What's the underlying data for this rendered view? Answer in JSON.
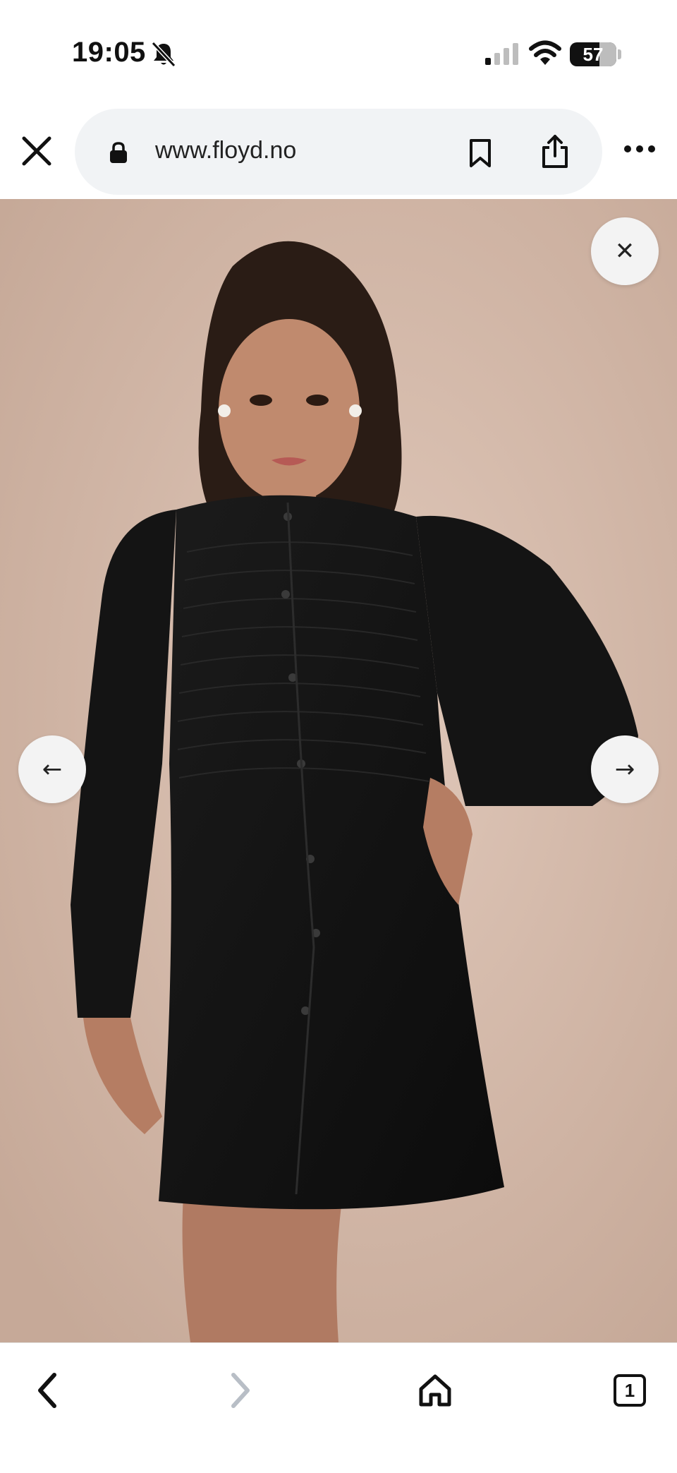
{
  "status_bar": {
    "time": "19:05",
    "battery_level": "57",
    "icons": [
      "bell-slash-icon",
      "cellular-signal-icon",
      "wifi-icon",
      "battery-icon"
    ]
  },
  "browser": {
    "url": "www.floyd.no",
    "icons": [
      "close-icon",
      "lock-icon",
      "bookmark-icon",
      "share-icon",
      "more-icon"
    ]
  },
  "product_image": {
    "close_glyph": "✕",
    "prev_glyph": "←",
    "next_glyph": "→"
  },
  "toolbar": {
    "tabs_count": "1",
    "icons": [
      "chevron-left-icon",
      "chevron-right-icon",
      "home-icon",
      "tabs-icon"
    ]
  },
  "colors": {
    "background": "#ffffff",
    "url_pill": "#f1f3f5",
    "photo_backdrop": "#d6bcac",
    "button_bg": "#f3f3f3",
    "disabled": "#b8bec6"
  }
}
